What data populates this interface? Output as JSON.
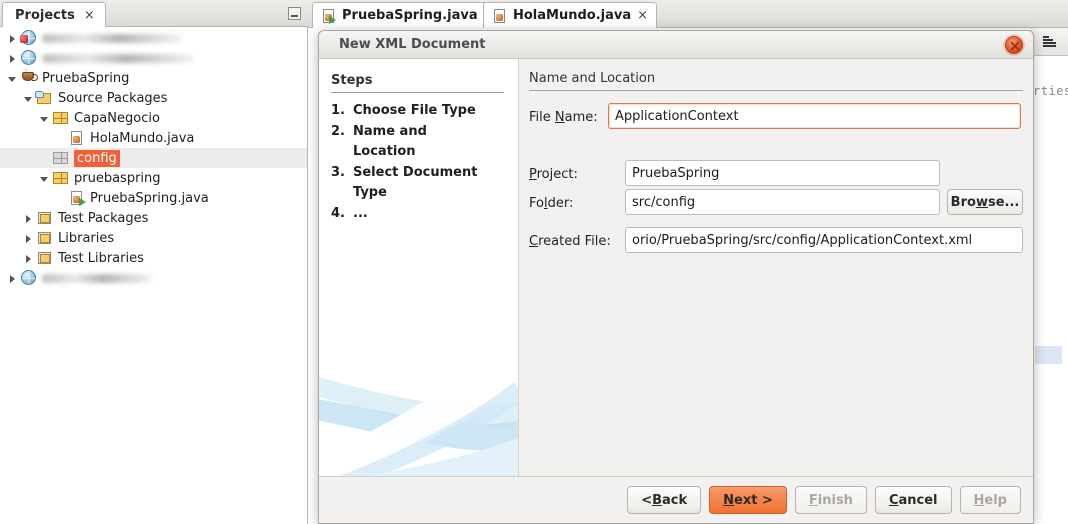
{
  "ide": {
    "projects_panel": {
      "tab_label": "Projects",
      "tab_close": "×",
      "minimize_icon": "minimize-icon",
      "tree": [
        {
          "indent": 0,
          "twisty": "closed",
          "icon": "globe-error-icon",
          "label": "",
          "blurred": true,
          "blur_width": 140
        },
        {
          "indent": 0,
          "twisty": "closed",
          "icon": "globe-icon",
          "label": "",
          "blurred": true,
          "blur_width": 152
        },
        {
          "indent": 0,
          "twisty": "open",
          "icon": "java-project-icon",
          "label": "PruebaSpring",
          "blurred": false
        },
        {
          "indent": 1,
          "twisty": "open",
          "icon": "source-packages-icon",
          "label": "Source Packages",
          "blurred": false
        },
        {
          "indent": 2,
          "twisty": "open",
          "icon": "package-icon",
          "label": "CapaNegocio",
          "blurred": false
        },
        {
          "indent": 3,
          "twisty": "none",
          "icon": "java-file-icon",
          "label": "HolaMundo.java",
          "blurred": false
        },
        {
          "indent": 2,
          "twisty": "none",
          "icon": "package-empty-icon",
          "label": "config",
          "blurred": false,
          "selected": true,
          "highlight": true
        },
        {
          "indent": 2,
          "twisty": "open",
          "icon": "package-icon",
          "label": "pruebaspring",
          "blurred": false
        },
        {
          "indent": 3,
          "twisty": "none",
          "icon": "java-main-file-icon",
          "label": "PruebaSpring.java",
          "blurred": false
        },
        {
          "indent": 1,
          "twisty": "closed",
          "icon": "test-packages-icon",
          "label": "Test Packages",
          "blurred": false
        },
        {
          "indent": 1,
          "twisty": "closed",
          "icon": "libraries-icon",
          "label": "Libraries",
          "blurred": false
        },
        {
          "indent": 1,
          "twisty": "closed",
          "icon": "test-libraries-icon",
          "label": "Test Libraries",
          "blurred": false
        },
        {
          "indent": 0,
          "twisty": "closed",
          "icon": "globe-icon",
          "label": "",
          "blurred": true,
          "blur_width": 110
        }
      ]
    },
    "editor_tabs": [
      {
        "label": "PruebaSpring.java",
        "icon": "java-main-file-icon",
        "close": "×",
        "active": true
      },
      {
        "label": "HolaMundo.java",
        "icon": "java-file-icon",
        "close": "×",
        "active": false
      }
    ],
    "properties_panel": {
      "icon": "properties-icon",
      "title_fragment": "rties"
    }
  },
  "dialog": {
    "title": "New XML Document",
    "close_icon": "close-icon",
    "steps": {
      "heading": "Steps",
      "items": [
        {
          "num": "1.",
          "label": "Choose File Type"
        },
        {
          "num": "2.",
          "label": "Name and Location"
        },
        {
          "num": "3.",
          "label": "Select Document Type"
        },
        {
          "num": "4.",
          "label": "..."
        }
      ]
    },
    "form": {
      "heading": "Name and Location",
      "file_name": {
        "label_before": "File ",
        "label_mnemonic": "N",
        "label_after": "ame:",
        "value": "ApplicationContext"
      },
      "project": {
        "label_mnemonic": "P",
        "label_after": "roject:",
        "value": "PruebaSpring"
      },
      "folder": {
        "label_before": "Fo",
        "label_mnemonic": "l",
        "label_after": "der:",
        "value": "src/config"
      },
      "browse_button": {
        "before": "Bro",
        "mnemonic": "w",
        "after": "se..."
      },
      "created_file": {
        "label_mnemonic": "C",
        "label_after": "reated File:",
        "value": "orio/PruebaSpring/src/config/ApplicationContext.xml"
      }
    },
    "buttons": [
      {
        "name": "back",
        "before": "< ",
        "mnemonic": "B",
        "after": "ack",
        "style": "normal"
      },
      {
        "name": "next",
        "before": "",
        "mnemonic": "N",
        "after": "ext >",
        "style": "primary"
      },
      {
        "name": "finish",
        "before": "",
        "mnemonic": "F",
        "after": "inish",
        "style": "disabled"
      },
      {
        "name": "cancel",
        "before": "",
        "mnemonic": "C",
        "after": "ancel",
        "style": "normal"
      },
      {
        "name": "help",
        "before": "",
        "mnemonic": "H",
        "after": "elp",
        "style": "disabled"
      }
    ]
  },
  "colors": {
    "accent_orange": "#f0613a",
    "primary_button": "#f0712f",
    "close_button": "#dd4814",
    "selection_blue": "#dde5f5"
  }
}
